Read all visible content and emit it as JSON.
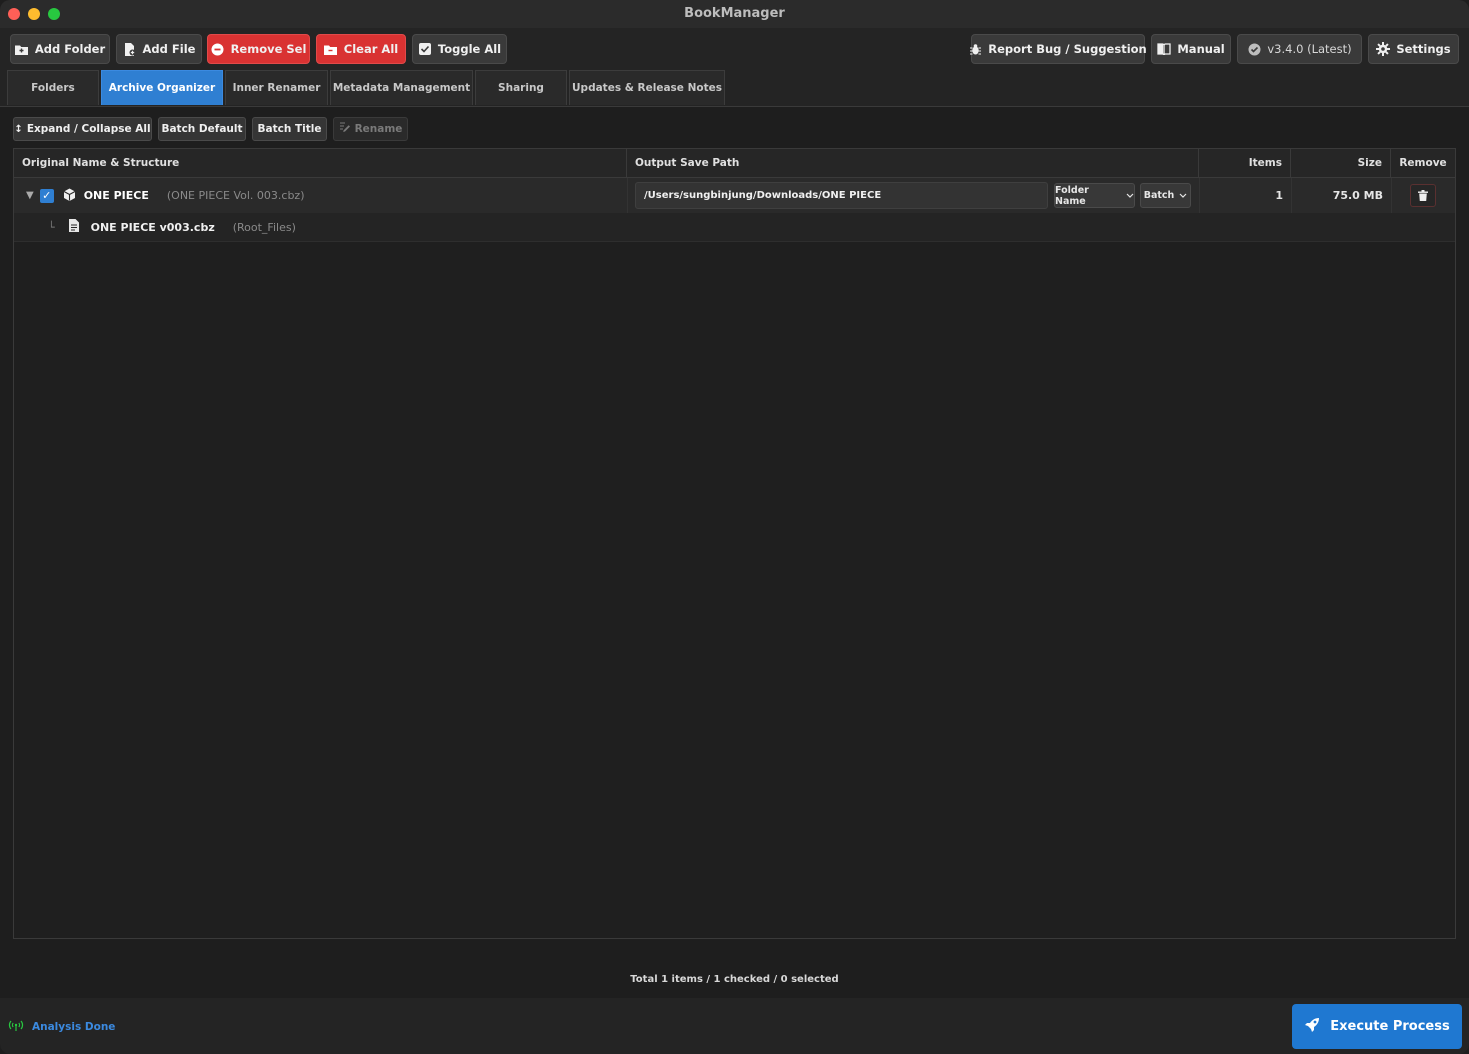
{
  "window": {
    "title": "BookManager"
  },
  "toolbar": {
    "add_folder": "Add Folder",
    "add_file": "Add File",
    "remove_sel": "Remove Sel",
    "clear_all": "Clear All",
    "toggle_all": "Toggle All",
    "report_bug": "Report Bug / Suggestion",
    "manual": "Manual",
    "version": "v3.4.0 (Latest)",
    "settings": "Settings"
  },
  "tabs": [
    {
      "label": "Folders"
    },
    {
      "label": "Archive Organizer",
      "active": true
    },
    {
      "label": "Inner Renamer"
    },
    {
      "label": "Metadata Management"
    },
    {
      "label": "Sharing"
    },
    {
      "label": "Updates & Release Notes"
    }
  ],
  "subtoolbar": {
    "expand_collapse": "Expand / Collapse All",
    "batch_default": "Batch Default",
    "batch_title": "Batch Title",
    "rename": "Rename"
  },
  "table": {
    "headers": {
      "name": "Original Name & Structure",
      "path": "Output Save Path",
      "items": "Items",
      "size": "Size",
      "remove": "Remove"
    },
    "rows": [
      {
        "name": "ONE PIECE",
        "subtitle": "(ONE PIECE Vol. 003.cbz)",
        "checked": true,
        "output_path": "/Users/sungbinjung/Downloads/ONE PIECE",
        "naming_mode": "Folder Name",
        "batch_mode": "Batch",
        "items": "1",
        "size": "75.0 MB",
        "children": [
          {
            "name": "ONE PIECE v003.cbz",
            "location": "(Root_Files)"
          }
        ]
      }
    ]
  },
  "summary": "Total 1 items / 1 checked / 0 selected",
  "status": {
    "text": "Analysis Done"
  },
  "execute_button": "Execute Process",
  "colors": {
    "accent": "#2f7fd2",
    "danger": "#d93232",
    "background": "#1e1e1e",
    "status_ok": "#28c840"
  }
}
